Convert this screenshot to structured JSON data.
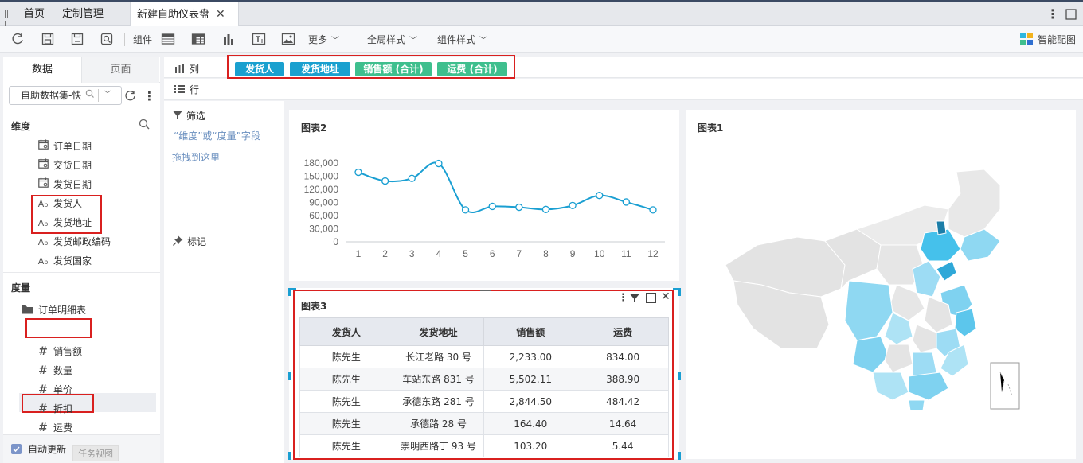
{
  "tabs": {
    "home": "首页",
    "custom": "定制管理",
    "active": "新建自助仪表盘",
    "close": "✕"
  },
  "window": {
    "more": "⋮",
    "maximize": "□"
  },
  "toolbar": {
    "component_label": "组件",
    "more_label": "更多",
    "global_style": "全局样式",
    "component_style": "组件样式",
    "smart_color": "智能配图"
  },
  "left_panel": {
    "tab_data": "数据",
    "tab_page": "页面",
    "dataset": "自助数据集-快",
    "dimension_title": "维度",
    "dimensions": [
      {
        "icon": "calendar-icon",
        "label": "订单日期"
      },
      {
        "icon": "calendar-icon",
        "label": "交货日期"
      },
      {
        "icon": "calendar-icon",
        "label": "发货日期"
      },
      {
        "icon": "text-icon",
        "label": "发货人"
      },
      {
        "icon": "text-icon",
        "label": "发货地址"
      },
      {
        "icon": "text-icon",
        "label": "发货邮政编码"
      },
      {
        "icon": "text-icon",
        "label": "发货国家"
      }
    ],
    "measure_title": "度量",
    "measure_folder": "订单明细表",
    "measures": [
      {
        "icon": "hash-icon",
        "label": "销售额"
      },
      {
        "icon": "hash-icon",
        "label": "数量"
      },
      {
        "icon": "hash-icon",
        "label": "单价"
      },
      {
        "icon": "hash-icon",
        "label": "折扣"
      },
      {
        "icon": "hash-icon",
        "label": "运费"
      }
    ],
    "auto_update": "自动更新",
    "task_view": "任务视图"
  },
  "shelf": {
    "column_label": "列",
    "row_label": "行",
    "pills": [
      {
        "label": "发货人",
        "kind": "dimension"
      },
      {
        "label": "发货地址",
        "kind": "dimension"
      },
      {
        "label": "销售额 (合计)",
        "kind": "measure"
      },
      {
        "label": "运费 (合计)",
        "kind": "measure"
      }
    ],
    "filter_label": "筛选",
    "filter_hint_line1": "“维度”或“度量”字段",
    "filter_hint_line2": "拖拽到这里",
    "mark_label": "标记"
  },
  "colors": {
    "dimension_pill": "#1aa0cf",
    "measure_pill": "#3fbf8e",
    "line": "#1a9fd2",
    "highlight": "#d9201f"
  },
  "chart2": {
    "title": "图表2",
    "chart_data": {
      "type": "line",
      "x": [
        1,
        2,
        3,
        4,
        5,
        6,
        7,
        8,
        9,
        10,
        11,
        12
      ],
      "values": [
        159000,
        139000,
        145000,
        179000,
        73000,
        81000,
        79000,
        74000,
        83000,
        106000,
        91000,
        73000
      ],
      "ylim": [
        0,
        180000
      ],
      "yticks": [
        "0",
        "30,000",
        "60,000",
        "90,000",
        "120,000",
        "150,000",
        "180,000"
      ],
      "xticks": [
        "1",
        "2",
        "3",
        "4",
        "5",
        "6",
        "7",
        "8",
        "9",
        "10",
        "11",
        "12"
      ]
    }
  },
  "chart1": {
    "title": "图表1"
  },
  "chart3": {
    "title": "图表3",
    "columns": [
      "发货人",
      "发货地址",
      "销售额",
      "运费"
    ],
    "rows": [
      [
        "陈先生",
        "长江老路 30 号",
        "2,233.00",
        "834.00"
      ],
      [
        "陈先生",
        "车站东路 831 号",
        "5,502.11",
        "388.90"
      ],
      [
        "陈先生",
        "承德东路 281 号",
        "2,844.50",
        "484.42"
      ],
      [
        "陈先生",
        "承德路 28 号",
        "164.40",
        "14.64"
      ],
      [
        "陈先生",
        "崇明西路丁 93 号",
        "103.20",
        "5.44"
      ]
    ]
  }
}
